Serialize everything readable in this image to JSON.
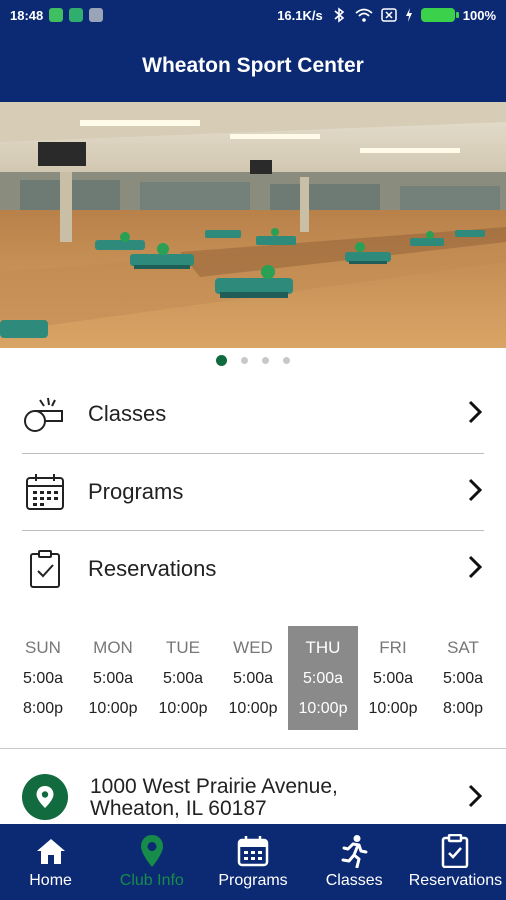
{
  "status_bar": {
    "time": "18:48",
    "network_speed": "16.1K/s",
    "battery": "100%",
    "icons": [
      "app-notification-icon",
      "app-notification-icon",
      "app-notification-icon",
      "bluetooth-icon",
      "wifi-icon",
      "sim-icon",
      "charging-icon",
      "battery-icon"
    ]
  },
  "header": {
    "title": "Wheaton Sport Center"
  },
  "carousel": {
    "slide_count": 4,
    "active_index": 0
  },
  "menu": {
    "items": [
      {
        "label": "Classes",
        "icon": "whistle-icon"
      },
      {
        "label": "Programs",
        "icon": "calendar-icon"
      },
      {
        "label": "Reservations",
        "icon": "clipboard-check-icon"
      }
    ]
  },
  "hours": {
    "days": [
      {
        "day": "SUN",
        "open": "5:00a",
        "close": "8:00p"
      },
      {
        "day": "MON",
        "open": "5:00a",
        "close": "10:00p"
      },
      {
        "day": "TUE",
        "open": "5:00a",
        "close": "10:00p"
      },
      {
        "day": "WED",
        "open": "5:00a",
        "close": "10:00p"
      },
      {
        "day": "THU",
        "open": "5:00a",
        "close": "10:00p",
        "today": true
      },
      {
        "day": "FRI",
        "open": "5:00a",
        "close": "10:00p"
      },
      {
        "day": "SAT",
        "open": "5:00a",
        "close": "8:00p"
      }
    ]
  },
  "address": {
    "line1": "1000 West Prairie Avenue,",
    "line2": "Wheaton, IL 60187",
    "icon": "location-pin-icon"
  },
  "bottom_nav": {
    "items": [
      {
        "label": "Home",
        "icon": "home-icon"
      },
      {
        "label": "Club Info",
        "icon": "location-pin-icon",
        "active": true
      },
      {
        "label": "Programs",
        "icon": "calendar-icon"
      },
      {
        "label": "Classes",
        "icon": "running-person-icon"
      },
      {
        "label": "Reservations",
        "icon": "clipboard-check-icon"
      }
    ]
  },
  "colors": {
    "brand_navy": "#0b2a73",
    "brand_green": "#116b3f",
    "today_highlight": "#8a8a8a"
  }
}
